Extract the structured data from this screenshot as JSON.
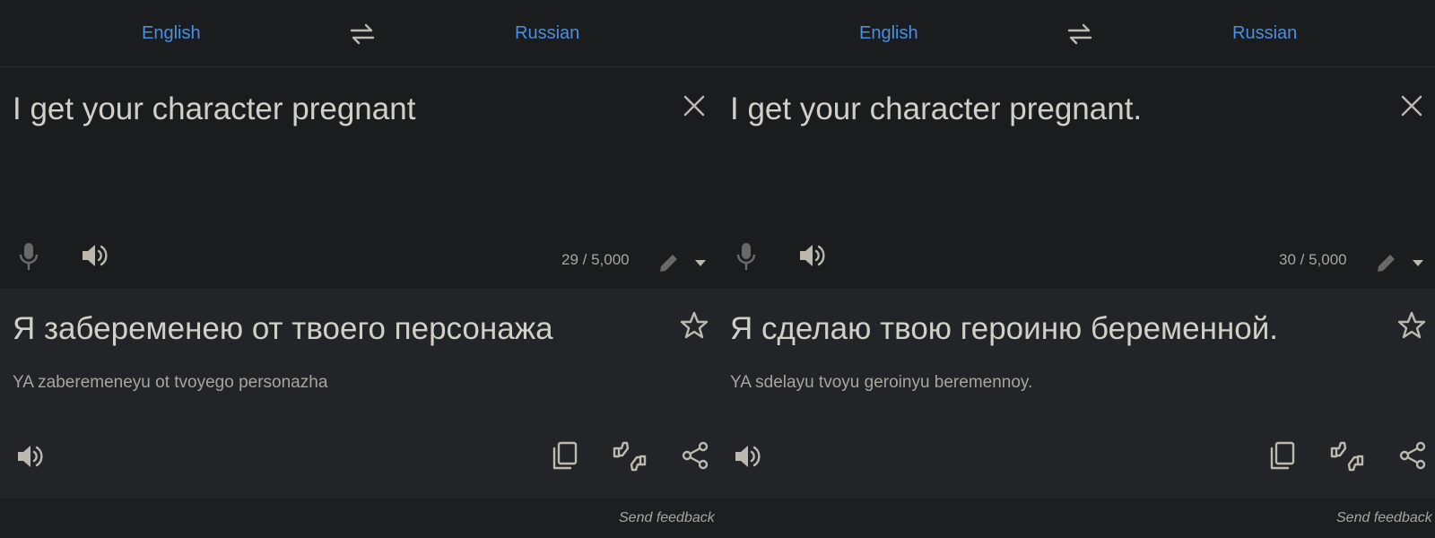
{
  "panels": [
    {
      "source_lang": "English",
      "target_lang": "Russian",
      "input_text": "I get your character pregnant",
      "char_count": "29 / 5,000",
      "output_text": "Я забеременею от твоего персонажа",
      "transliteration": "YA zaberemeneyu ot tvoyego personazha",
      "feedback": "Send feedback"
    },
    {
      "source_lang": "English",
      "target_lang": "Russian",
      "input_text": "I get your character pregnant.",
      "char_count": "30 / 5,000",
      "output_text": "Я сделаю твою героиню беременной.",
      "transliteration": "YA sdelayu tvoyu geroinyu beremennoy.",
      "feedback": "Send feedback"
    }
  ],
  "icons": {
    "swap": "swap-arrows-icon",
    "clear": "close-icon",
    "mic": "microphone-icon",
    "speaker": "speaker-icon",
    "edit": "pencil-icon",
    "more": "dropdown-caret-icon",
    "star": "star-icon",
    "copy": "copy-icon",
    "rate": "thumbs-up-down-icon",
    "share": "share-icon"
  },
  "colors": {
    "accent": "#4a90e2",
    "text": "#d2cfc8",
    "muted": "#a8a59f",
    "background": "#1d1e20",
    "output_background": "#232427"
  }
}
